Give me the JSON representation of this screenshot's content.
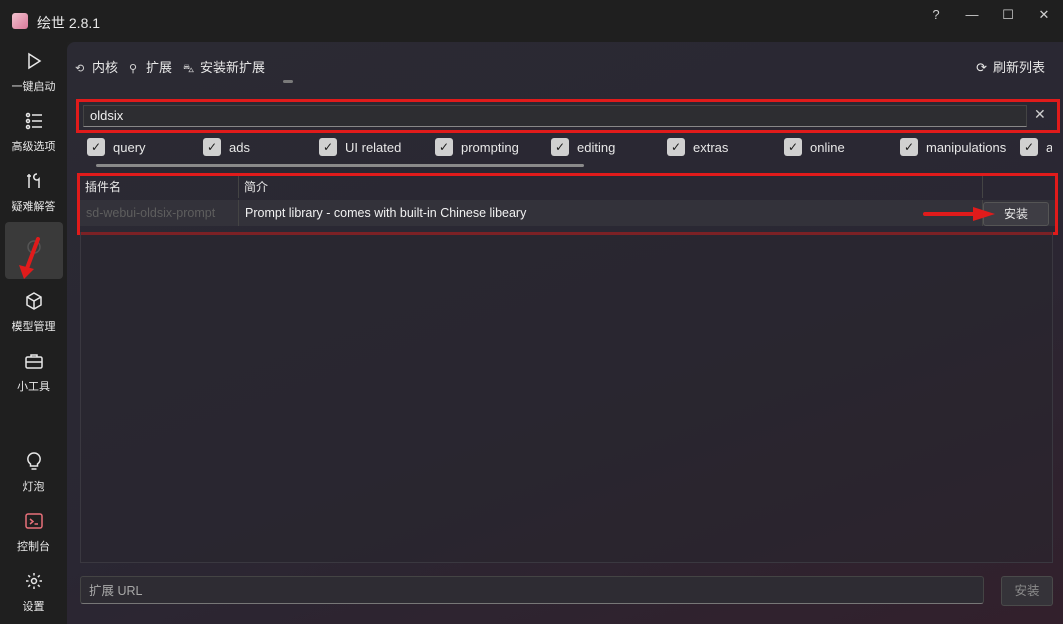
{
  "app": {
    "title": "绘世 2.8.1"
  },
  "window_controls": {
    "help": "?",
    "minimize": "—",
    "maximize": "☐",
    "close": "✕"
  },
  "sidebar": {
    "items": [
      {
        "label": "一键启动",
        "icon": "play-icon"
      },
      {
        "label": "高级选项",
        "icon": "list-settings-icon"
      },
      {
        "label": "疑难解答",
        "icon": "tools-icon"
      },
      {
        "label": "",
        "icon": "extension-icon"
      },
      {
        "label": "模型管理",
        "icon": "cube-icon"
      },
      {
        "label": "小工具",
        "icon": "toolbox-icon"
      },
      {
        "label": "灯泡",
        "icon": "lightbulb-icon"
      },
      {
        "label": "控制台",
        "icon": "terminal-icon"
      },
      {
        "label": "设置",
        "icon": "gear-icon"
      }
    ]
  },
  "tabs": [
    {
      "label": "内核",
      "icon": "history-icon"
    },
    {
      "label": "扩展",
      "icon": "link-icon"
    },
    {
      "label": "安装新扩展",
      "icon": "cart-icon"
    }
  ],
  "refresh": {
    "label": "刷新列表",
    "icon": "refresh-icon"
  },
  "search": {
    "value": "oldsix",
    "clear": "✕"
  },
  "filters": [
    {
      "label": "query",
      "checked": true
    },
    {
      "label": "ads",
      "checked": true
    },
    {
      "label": "UI related",
      "checked": true
    },
    {
      "label": "prompting",
      "checked": true
    },
    {
      "label": "editing",
      "checked": true
    },
    {
      "label": "extras",
      "checked": true
    },
    {
      "label": "online",
      "checked": true
    },
    {
      "label": "manipulations",
      "checked": true
    },
    {
      "label": "a",
      "checked": true
    }
  ],
  "table": {
    "headers": [
      "插件名",
      "简介",
      ""
    ],
    "rows": [
      {
        "name": "sd-webui-oldsix-prompt",
        "description": "Prompt library - comes with built-in Chinese libeary",
        "action": "安装"
      }
    ]
  },
  "url_field": {
    "placeholder": "扩展 URL",
    "install": "安装"
  },
  "colors": {
    "highlight": "#e01b1b",
    "accent_bg": "#2b2a33"
  }
}
